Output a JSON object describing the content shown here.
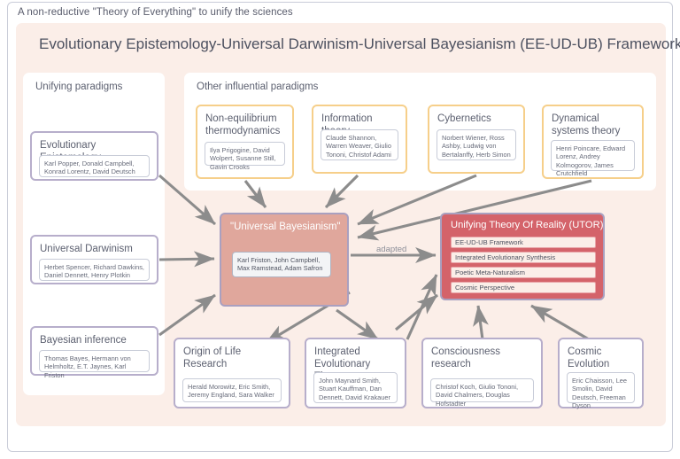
{
  "caption": "A non-reductive \"Theory of Everything\" to unify the sciences",
  "framework": {
    "title": "Evolutionary Epistemology-Universal Darwinism-Universal Bayesianism (EE-UD-UB) Framework",
    "bg_color": "#fbeee8"
  },
  "groups": {
    "unifying": {
      "title": "Unifying paradigms"
    },
    "other": {
      "title": "Other influential paradigms"
    }
  },
  "unifying_cards": [
    {
      "title": "Evolutionary Epistemology",
      "people": "Karl Popper, Donald Campbell, Konrad Lorentz, David Deutsch",
      "border_color": "#b7aecb"
    },
    {
      "title": "Universal Darwinism",
      "people": "Herbet Spencer, Richard Dawkins, Daniel Dennett, Henry Plotkin",
      "border_color": "#b7aecb"
    },
    {
      "title": "Bayesian inference",
      "people": "Thomas Bayes, Hermann von Helmholtz, E.T. Jaynes, Karl Friston",
      "border_color": "#b7aecb"
    }
  ],
  "other_cards": [
    {
      "title": "Non-equilibrium thermodynamics",
      "people": "Ilya Prigogine, David Wolpert, Susanne Still, Gavin Crooks",
      "border_color": "#f6cf8a"
    },
    {
      "title": "Information theory",
      "people": "Claude Shannon, Warren Weaver, Giulio Tononi, Christof Adami",
      "border_color": "#f6cf8a"
    },
    {
      "title": "Cybernetics",
      "people": "Norbert Wiener, Ross Ashby, Ludwig von Bertalanffy, Herb Simon",
      "border_color": "#f6cf8a"
    },
    {
      "title": "Dynamical systems theory",
      "people": "Henri Poincare, Edward Lorenz, Andrey Kolmogorov, James Crutchfield",
      "border_color": "#f6cf8a"
    }
  ],
  "bottom_cards": [
    {
      "title": "Origin of Life Research",
      "people": "Herald Morowitz, Eric Smith, Jeremy England, Sara Walker",
      "border_color": "#b7aecb"
    },
    {
      "title": "Integrated Evolutionary Theory",
      "people": "John Maynard Smith, Stuart  Kauffman, Dan Dennett, David Krakauer",
      "border_color": "#b7aecb"
    },
    {
      "title": "Consciousness research",
      "people": "Christof Koch, Giulio Tononi, David Chalmers, Douglas Hofstadter",
      "border_color": "#b7aecb"
    },
    {
      "title": "Cosmic Evolution",
      "people": "Eric Chaisson, Lee Smolin, David Deutsch, Freeman Dyson",
      "border_color": "#b7aecb"
    }
  ],
  "universal_bayesianism": {
    "title": "\"Universal Bayesianism\"",
    "people": "Karl Friston, John Campbell, Max Ramstead, Adam Safron",
    "fill_color": "#e0a79c"
  },
  "utor": {
    "title": "Unifying Theory Of Reality (UTOR)",
    "fill_color": "#d4636a",
    "items": [
      "EE-UD-UB Framework",
      "Integrated Evolutionary Synthesis",
      "Poetic Meta-Naturalism",
      "Cosmic Perspective"
    ]
  },
  "edges": {
    "adapted_label": "adapted",
    "stroke_color": "#8c8c8c"
  }
}
